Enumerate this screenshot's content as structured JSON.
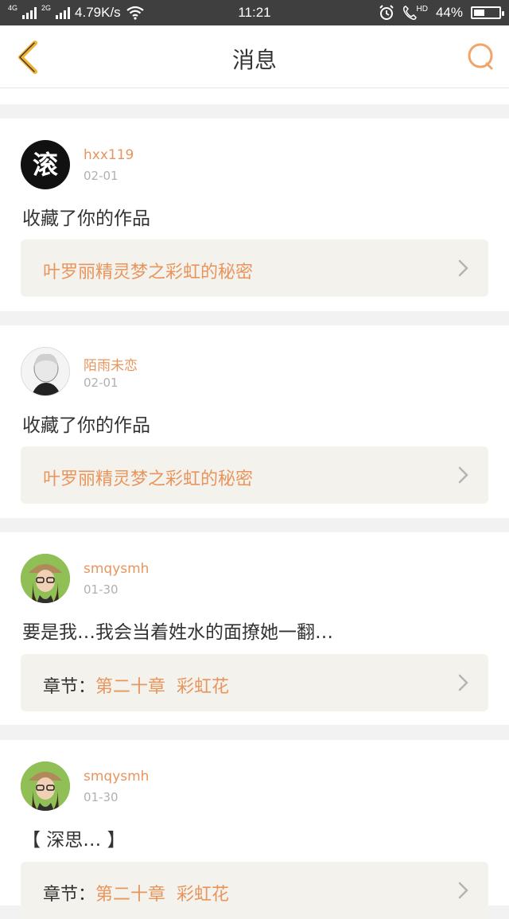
{
  "status_bar": {
    "network_1": "4G",
    "network_2": "2G",
    "speed": "4.79K/s",
    "time": "11:21",
    "hd": "HD",
    "battery": "44%",
    "battery_level": 0.44
  },
  "header": {
    "title": "消息"
  },
  "messages": [
    {
      "username": "hxx119",
      "date": "02-01",
      "text": "收藏了你的作品",
      "ref_label": "",
      "ref_title": "叶罗丽精灵梦之彩虹的秘密",
      "avatar_char": "滚"
    },
    {
      "username": "陌雨未恋",
      "date": "02-01",
      "text": "收藏了你的作品",
      "ref_label": "",
      "ref_title": "叶罗丽精灵梦之彩虹的秘密"
    },
    {
      "username": "smqysmh",
      "date": "01-30",
      "text": "要是我…我会当着姓水的面撩她一翻…",
      "ref_label": "章节：",
      "ref_title": "第二十章  彩虹花"
    },
    {
      "username": "smqysmh",
      "date": "01-30",
      "text": "【 深思… 】",
      "ref_label": "章节：",
      "ref_title": "第二十章  彩虹花"
    }
  ],
  "colors": {
    "accent": "#e8955d",
    "back_arrow": "#f2b233",
    "card_ref_bg": "#f3f2ec",
    "page_bg": "#f2f2f2"
  },
  "icons": {
    "back": "chevron-left-icon",
    "search": "search-icon",
    "wifi": "wifi-icon",
    "alarm": "alarm-icon",
    "phone": "phone-icon",
    "chevron": "chevron-right-icon"
  }
}
